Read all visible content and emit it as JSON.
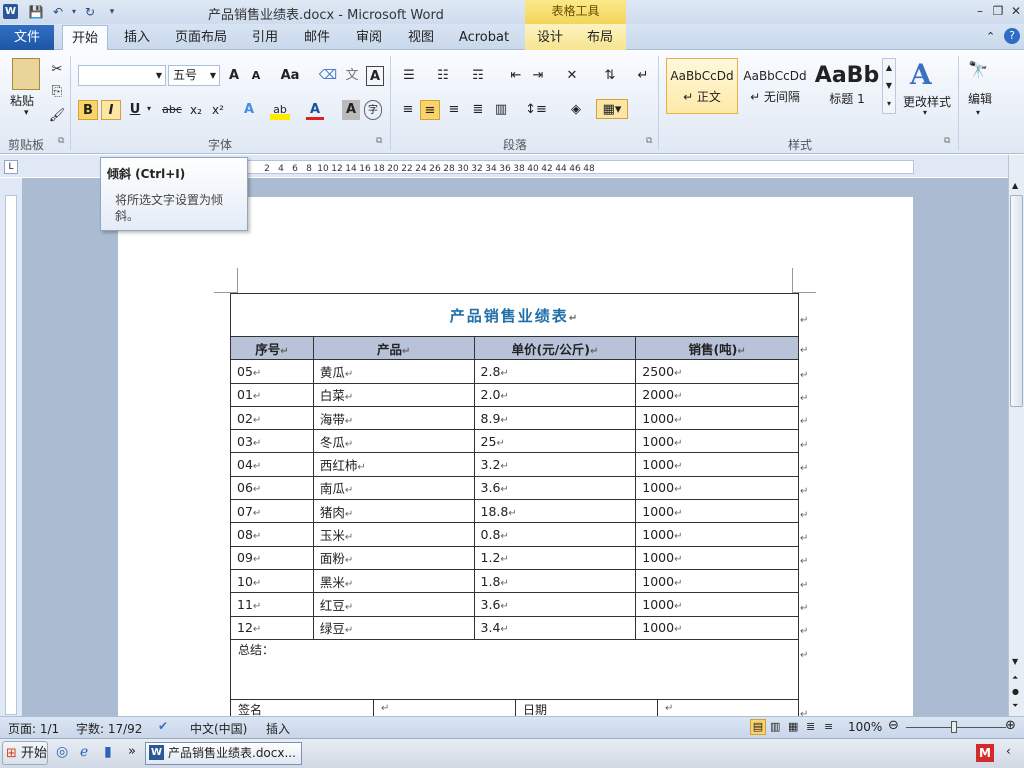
{
  "titlebar": {
    "title": "产品销售业绩表.docx - Microsoft Word",
    "table_tools": "表格工具",
    "app_icon": "W"
  },
  "tabs": {
    "file": "文件",
    "home": "开始",
    "insert": "插入",
    "layout": "页面布局",
    "references": "引用",
    "mailings": "邮件",
    "review": "审阅",
    "view": "视图",
    "acrobat": "Acrobat",
    "design": "设计",
    "table_layout": "布局"
  },
  "ribbon": {
    "clipboard": {
      "paste": "粘贴",
      "label": "剪贴板"
    },
    "font": {
      "font_name": "",
      "font_size": "五号",
      "label": "字体",
      "bold": "B",
      "italic": "I",
      "underline": "U",
      "strike": "abc",
      "sub": "x₂",
      "sup": "x²",
      "grow": "A",
      "shrink": "A",
      "case": "Aa",
      "font_color": "A",
      "highlight": "ab",
      "char_shade": "A"
    },
    "paragraph": {
      "label": "段落"
    },
    "styles": {
      "label": "样式",
      "normal_preview": "AaBbCcDd",
      "normal": "↵ 正文",
      "nospacing_preview": "AaBbCcDd",
      "nospacing": "↵ 无间隔",
      "h1_preview": "AaBb",
      "h1": "标题 1",
      "change": "更改样式"
    },
    "editing": {
      "label": "编辑"
    }
  },
  "tooltip": {
    "title": "倾斜 (Ctrl+I)",
    "body": "将所选文字设置为倾斜。"
  },
  "ruler": {
    "ticks": [
      "2",
      "4",
      "6",
      "8",
      "10",
      "12",
      "14",
      "16",
      "18",
      "20",
      "22",
      "24",
      "26",
      "28",
      "30",
      "32",
      "34",
      "36",
      "38",
      "40",
      "42",
      "44",
      "46",
      "48"
    ]
  },
  "table": {
    "title": "产品销售业绩表",
    "headers": [
      "序号",
      "产品",
      "单价(元/公斤)",
      "销售(吨)"
    ],
    "rows": [
      [
        "05",
        "黄瓜",
        "2.8",
        "2500"
      ],
      [
        "01",
        "白菜",
        "2.0",
        "2000"
      ],
      [
        "02",
        "海带",
        "8.9",
        "1000"
      ],
      [
        "03",
        "冬瓜",
        "25",
        "1000"
      ],
      [
        "04",
        "西红柿",
        "3.2",
        "1000"
      ],
      [
        "06",
        "南瓜",
        "3.6",
        "1000"
      ],
      [
        "07",
        "猪肉",
        "18.8",
        "1000"
      ],
      [
        "08",
        "玉米",
        "0.8",
        "1000"
      ],
      [
        "09",
        "面粉",
        "1.2",
        "1000"
      ],
      [
        "10",
        "黑米",
        "1.8",
        "1000"
      ],
      [
        "11",
        "红豆",
        "3.6",
        "1000"
      ],
      [
        "12",
        "绿豆",
        "3.4",
        "1000"
      ]
    ],
    "summary": "总结：",
    "sign": "签名",
    "date": "日期"
  },
  "statusbar": {
    "page": "页面: 1/1",
    "words": "字数: 17/92",
    "lang": "中文(中国)",
    "mode": "插入",
    "zoom": "100%"
  },
  "taskbar": {
    "start": "开始",
    "word_task": "产品销售业绩表.docx..."
  }
}
